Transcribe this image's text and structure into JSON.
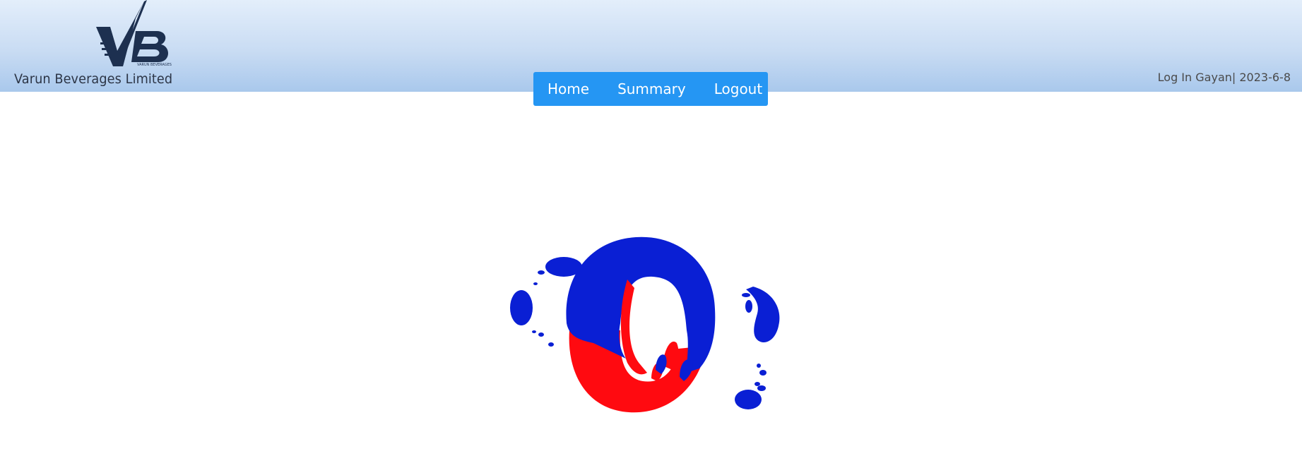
{
  "brand": {
    "company_name": "Varun Beverages Limited",
    "logo_icon": "vb-logo-icon",
    "logo_small_text": "VARUN BEVERAGES"
  },
  "nav": {
    "items": [
      {
        "label": "Home"
      },
      {
        "label": "Summary"
      },
      {
        "label": "Logout"
      }
    ]
  },
  "user": {
    "prefix": "Log In",
    "name": "Gayan",
    "separator": "|",
    "date": "2023-6-8"
  },
  "loader": {
    "icon": "loading-spinner-icon"
  },
  "colors": {
    "header_top": "#e3eefb",
    "header_bottom": "#a9c8ec",
    "nav_bg": "#2596f3",
    "nav_text": "#ffffff",
    "logo_navy": "#1d3050",
    "loader_blue": "#0a1fd4",
    "loader_red": "#ff0a10"
  }
}
